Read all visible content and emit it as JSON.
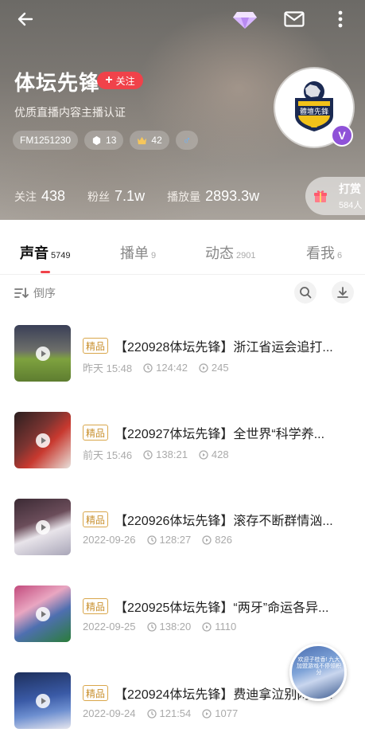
{
  "header": {
    "name": "体坛先锋",
    "follow_label": "关注",
    "certification": "优质直播内容主播认证",
    "chips": [
      {
        "icon": "fm-id",
        "text": "FM1251230"
      },
      {
        "icon": "level-icon",
        "text": "13"
      },
      {
        "icon": "crown-icon",
        "text": "42"
      },
      {
        "icon": "male-icon",
        "text": "♂"
      }
    ],
    "avatar_text": "體壇先鋒",
    "verify_mark": "V",
    "stats": [
      {
        "label": "关注",
        "value": "438"
      },
      {
        "label": "粉丝",
        "value": "7.1w"
      },
      {
        "label": "播放量",
        "value": "2893.3w"
      }
    ],
    "tip": {
      "label": "打赏",
      "count": "584人"
    }
  },
  "tabs": [
    {
      "label": "声音",
      "count": "5749",
      "active": true
    },
    {
      "label": "播单",
      "count": "9"
    },
    {
      "label": "动态",
      "count": "2901"
    },
    {
      "label": "看我",
      "count": "6"
    }
  ],
  "sort": {
    "label": "倒序"
  },
  "items": [
    {
      "badge": "精品",
      "title": "【220928体坛先锋】浙江省运会追打...",
      "date": "昨天 15:48",
      "duration": "124:42",
      "plays": "245"
    },
    {
      "badge": "精品",
      "title": "【220927体坛先锋】全世界“科学养...",
      "date": "前天 15:46",
      "duration": "138:21",
      "plays": "428"
    },
    {
      "badge": "精品",
      "title": "【220926体坛先锋】滚存不断群情汹...",
      "date": "2022-09-26",
      "duration": "128:27",
      "plays": "826"
    },
    {
      "badge": "精品",
      "title": "【220925体坛先锋】“两牙”命运各异...",
      "date": "2022-09-25",
      "duration": "138:20",
      "plays": "1110"
    },
    {
      "badge": "精品",
      "title": "【220924体坛先锋】费迪拿泣别网坛...",
      "date": "2022-09-24",
      "duration": "121:54",
      "plays": "1077"
    }
  ],
  "float_ad": {
    "text": "欢迎子桂香! 九大加盟游戏不停领积分"
  },
  "colors": {
    "accent": "#f0424a",
    "badge": "#c9902e",
    "verify": "#8f52d8"
  }
}
